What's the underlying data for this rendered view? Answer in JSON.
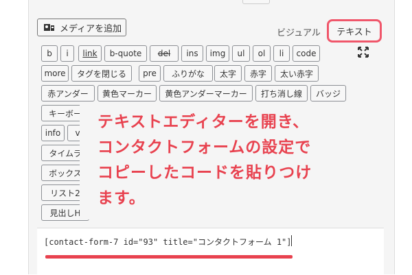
{
  "editor": {
    "add_media_label": "メディアを追加",
    "tabs": {
      "visual": "ビジュアル",
      "text": "テキスト"
    }
  },
  "toolbar": {
    "row1": [
      "b",
      "i",
      "link",
      "b-quote",
      "del",
      "ins",
      "img",
      "ul",
      "ol",
      "li",
      "code"
    ],
    "row2": [
      "more",
      "タグを閉じる",
      "pre",
      "ふりがな",
      "太字",
      "赤字",
      "太い赤字"
    ],
    "row3": [
      "赤アンダー",
      "黄色マーカー",
      "黄色アンダーマーカー",
      "打ち消し線",
      "バッジ"
    ],
    "row4": [
      "キーボー"
    ],
    "row5": [
      "info",
      "v"
    ],
    "row6": [
      "タイムラ"
    ],
    "row7": [
      "ボックス"
    ],
    "row8": [
      "リスト2"
    ],
    "row9": [
      "見出しH"
    ]
  },
  "annotation": {
    "lines": [
      "テキストエディターを開き、",
      "コンタクトフォームの設定で",
      "コピーしたコードを貼りつけ",
      "ます。"
    ]
  },
  "content": {
    "code": "[contact-form-7 id=\"93\" title=\"コンタクトフォーム 1\"]"
  },
  "colors": {
    "highlight": "#f0566a",
    "annotation": "#e8424f"
  }
}
